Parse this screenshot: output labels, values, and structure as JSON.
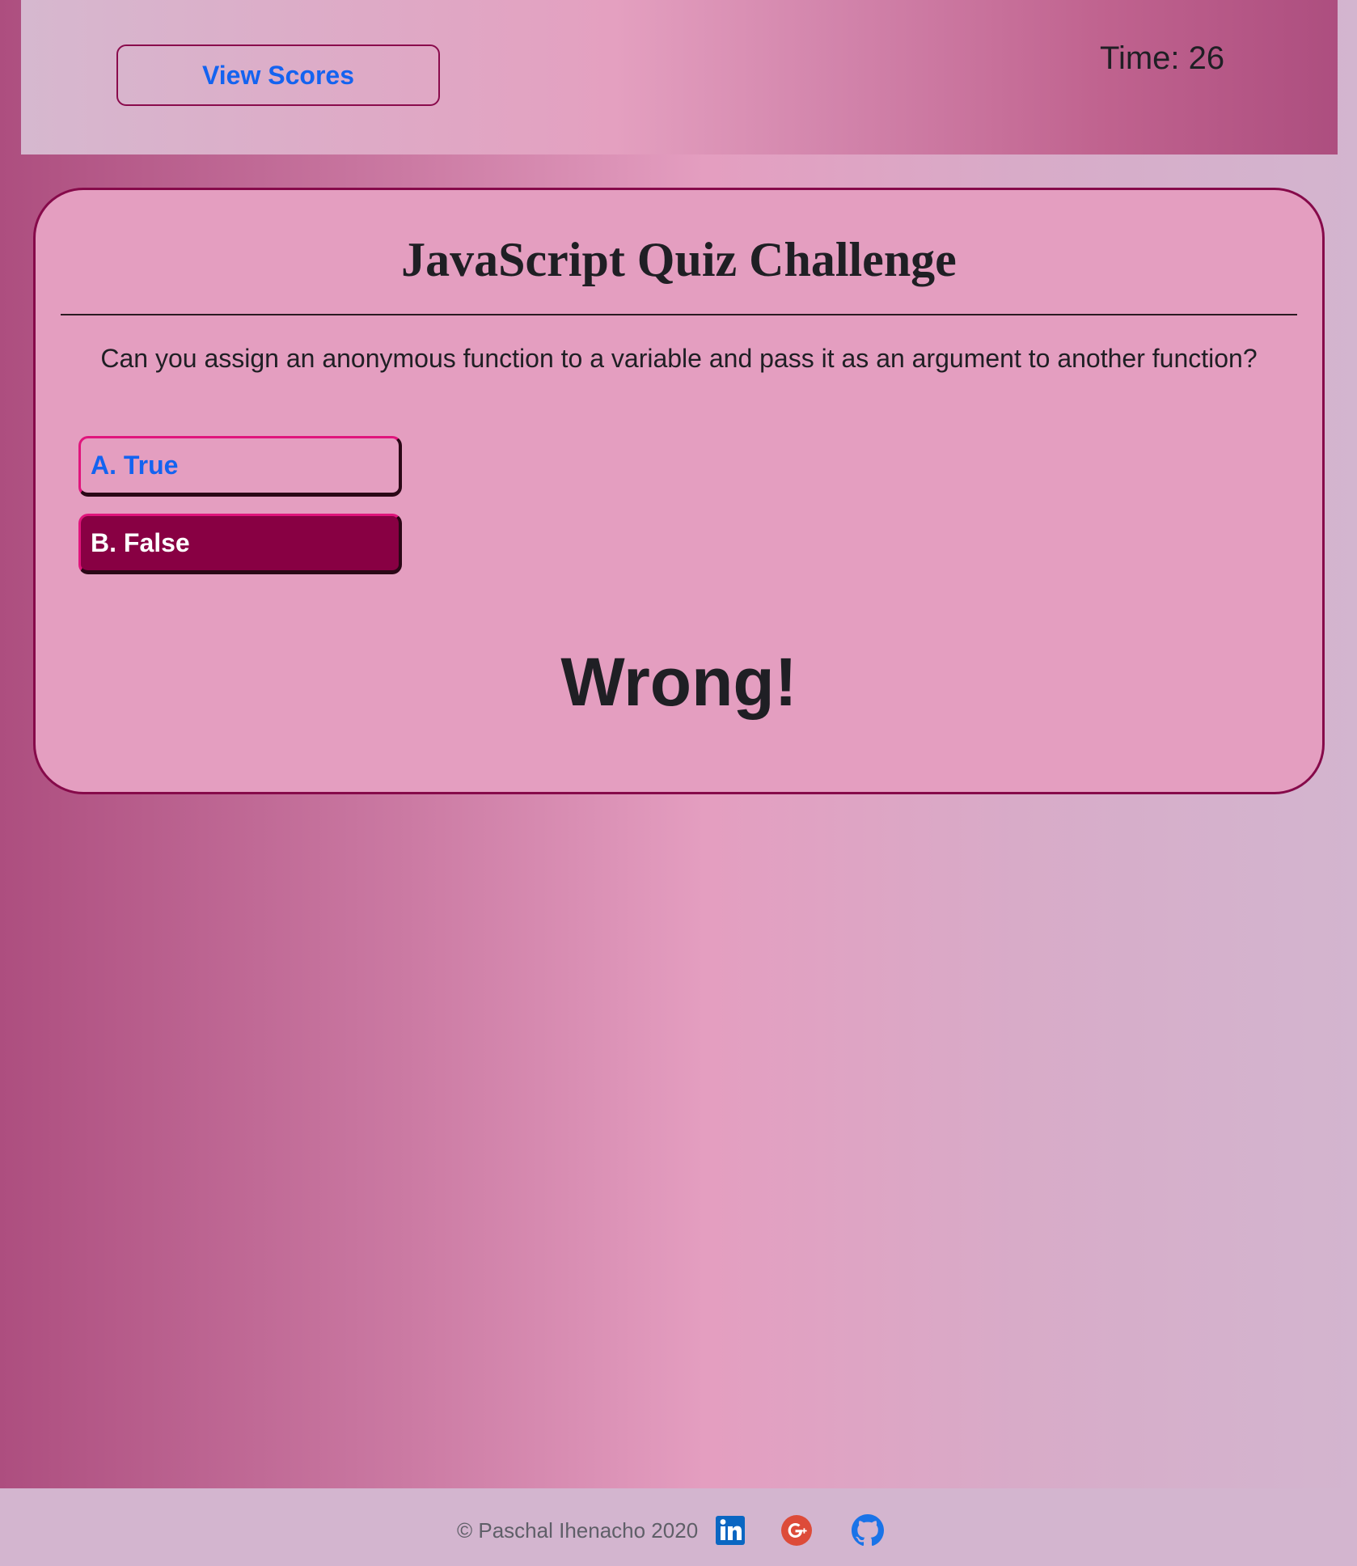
{
  "header": {
    "view_scores_label": "View Scores",
    "timer_text": "Time: 26"
  },
  "quiz": {
    "title": "JavaScript Quiz Challenge",
    "question": "Can you assign an anonymous function to a variable and pass it as an argument to another function?",
    "answers": [
      {
        "label": "A. True"
      },
      {
        "label": "B. False"
      }
    ],
    "feedback": "Wrong!"
  },
  "footer": {
    "copyright": "© Paschal Ihenacho 2020",
    "social_icons": [
      "linkedin-icon",
      "google-plus-icon",
      "github-icon"
    ]
  },
  "colors": {
    "accent": "#880043",
    "border": "#860a4a",
    "link": "#1463f0",
    "card_background": "#e49ec0"
  }
}
